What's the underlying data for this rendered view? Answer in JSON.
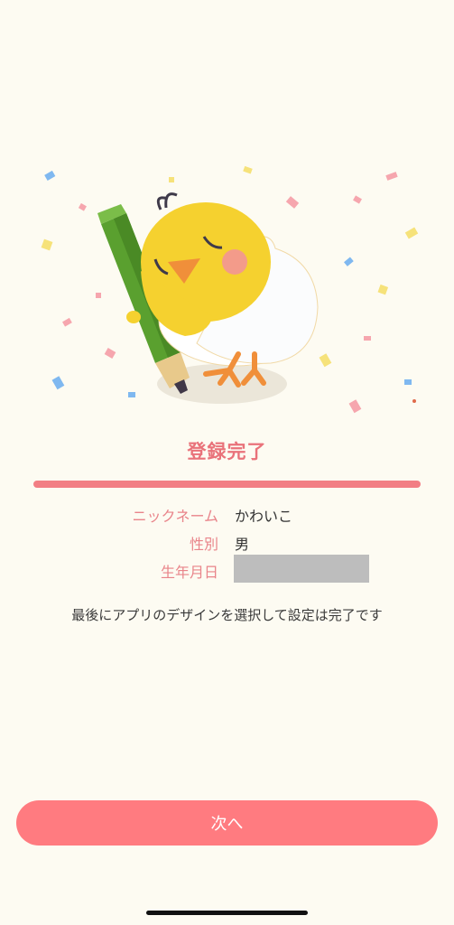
{
  "title": "登録完了",
  "progress": 1.0,
  "profile": {
    "nickname": {
      "label": "ニックネーム",
      "value": "かわいこ"
    },
    "gender": {
      "label": "性別",
      "value": "男"
    },
    "birthday": {
      "label": "生年月日",
      "value": ""
    }
  },
  "message": "最後にアプリのデザインを選択して設定は完了です",
  "next_button": {
    "label": "次へ"
  },
  "colors": {
    "background": "#fdfbf2",
    "accent": "#f27e84",
    "button": "#ff7b80",
    "label": "#e9848a"
  }
}
